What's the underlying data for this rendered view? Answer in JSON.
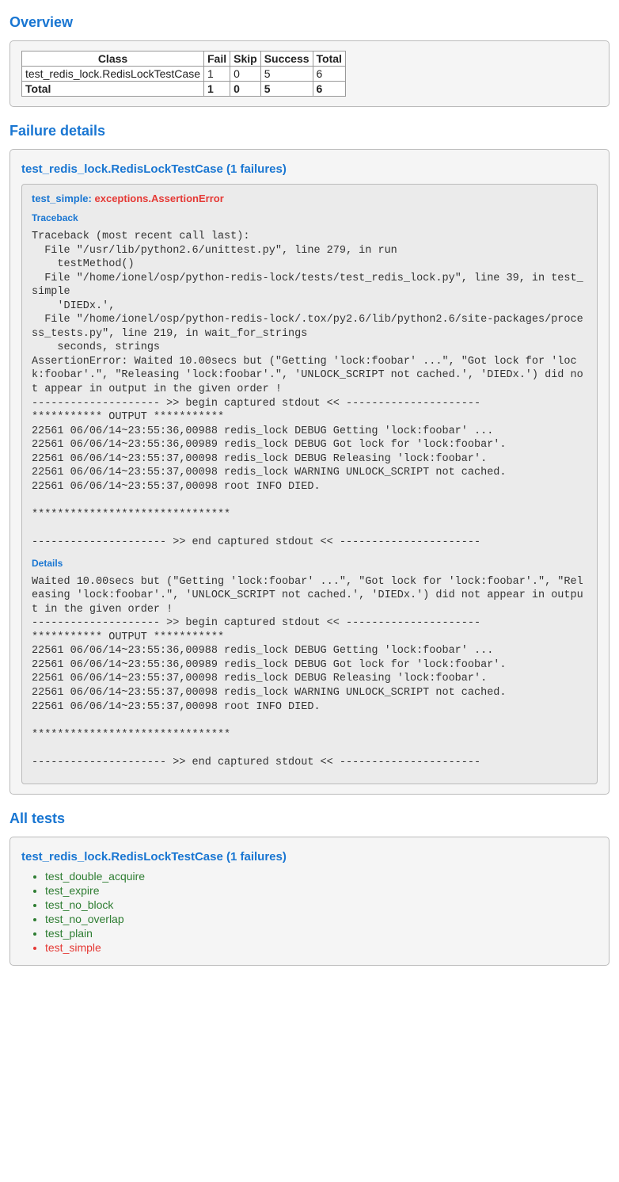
{
  "headings": {
    "overview": "Overview",
    "failure_details": "Failure details",
    "all_tests": "All tests"
  },
  "table": {
    "headers": {
      "class": "Class",
      "fail": "Fail",
      "skip": "Skip",
      "success": "Success",
      "total": "Total"
    },
    "rows": [
      {
        "class": "test_redis_lock.RedisLockTestCase",
        "fail": "1",
        "skip": "0",
        "success": "5",
        "total": "6",
        "bold": false
      },
      {
        "class": "Total",
        "fail": "1",
        "skip": "0",
        "success": "5",
        "total": "6",
        "bold": true
      }
    ]
  },
  "failure": {
    "suite_title": "test_redis_lock.RedisLockTestCase (1 failures)",
    "test_name": "test_simple:",
    "error": "exceptions.AssertionError",
    "traceback_label": "Traceback",
    "traceback": "Traceback (most recent call last):\n  File \"/usr/lib/python2.6/unittest.py\", line 279, in run\n    testMethod()\n  File \"/home/ionel/osp/python-redis-lock/tests/test_redis_lock.py\", line 39, in test_simple\n    'DIEDx.',\n  File \"/home/ionel/osp/python-redis-lock/.tox/py2.6/lib/python2.6/site-packages/process_tests.py\", line 219, in wait_for_strings\n    seconds, strings\nAssertionError: Waited 10.00secs but (\"Getting 'lock:foobar' ...\", \"Got lock for 'lock:foobar'.\", \"Releasing 'lock:foobar'.\", 'UNLOCK_SCRIPT not cached.', 'DIEDx.') did not appear in output in the given order !\n-------------------- >> begin captured stdout << ---------------------\n*********** OUTPUT ***********\n22561 06/06/14~23:55:36,00988 redis_lock DEBUG Getting 'lock:foobar' ...\n22561 06/06/14~23:55:36,00989 redis_lock DEBUG Got lock for 'lock:foobar'.\n22561 06/06/14~23:55:37,00098 redis_lock DEBUG Releasing 'lock:foobar'.\n22561 06/06/14~23:55:37,00098 redis_lock WARNING UNLOCK_SCRIPT not cached.\n22561 06/06/14~23:55:37,00098 root INFO DIED.\n\n*******************************\n\n--------------------- >> end captured stdout << ----------------------",
    "details_label": "Details",
    "details": "Waited 10.00secs but (\"Getting 'lock:foobar' ...\", \"Got lock for 'lock:foobar'.\", \"Releasing 'lock:foobar'.\", 'UNLOCK_SCRIPT not cached.', 'DIEDx.') did not appear in output in the given order !\n-------------------- >> begin captured stdout << ---------------------\n*********** OUTPUT ***********\n22561 06/06/14~23:55:36,00988 redis_lock DEBUG Getting 'lock:foobar' ...\n22561 06/06/14~23:55:36,00989 redis_lock DEBUG Got lock for 'lock:foobar'.\n22561 06/06/14~23:55:37,00098 redis_lock DEBUG Releasing 'lock:foobar'.\n22561 06/06/14~23:55:37,00098 redis_lock WARNING UNLOCK_SCRIPT not cached.\n22561 06/06/14~23:55:37,00098 root INFO DIED.\n\n*******************************\n\n--------------------- >> end captured stdout << ----------------------"
  },
  "all_tests": {
    "suite_title": "test_redis_lock.RedisLockTestCase (1 failures)",
    "tests": [
      {
        "name": "test_double_acquire",
        "status": "pass"
      },
      {
        "name": "test_expire",
        "status": "pass"
      },
      {
        "name": "test_no_block",
        "status": "pass"
      },
      {
        "name": "test_no_overlap",
        "status": "pass"
      },
      {
        "name": "test_plain",
        "status": "pass"
      },
      {
        "name": "test_simple",
        "status": "fail"
      }
    ]
  }
}
